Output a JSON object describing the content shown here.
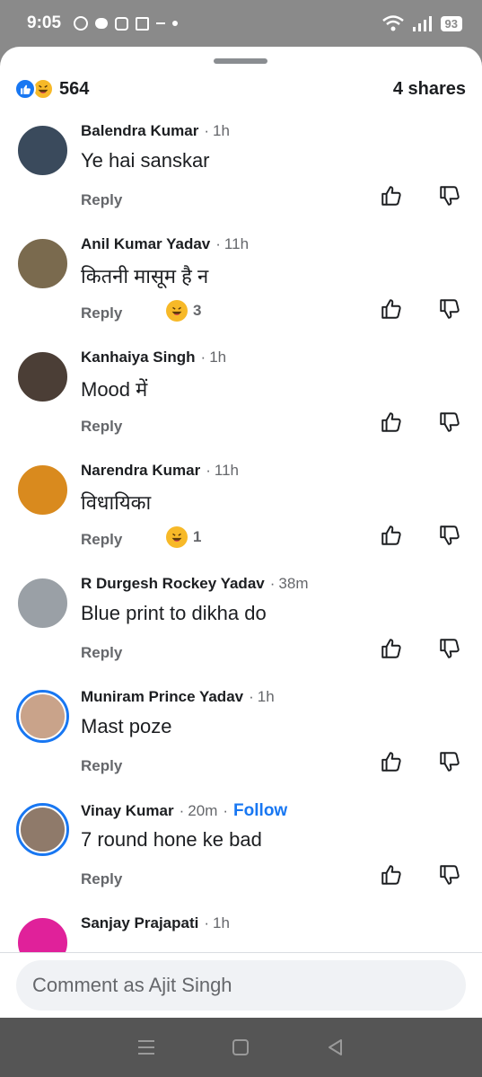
{
  "status_bar": {
    "time": "9:05",
    "battery": "93"
  },
  "summary": {
    "reaction_count": "564",
    "shares": "4 shares"
  },
  "comments": [
    {
      "name": "Balendra Kumar",
      "time": "1h",
      "text": "Ye hai sanskar",
      "reply": "Reply",
      "haha_count": null,
      "avatar_color": "#3a4a5c",
      "ring": false,
      "follow": null
    },
    {
      "name": "Anil Kumar Yadav",
      "time": "11h",
      "text": "कितनी मासूम है न",
      "reply": "Reply",
      "haha_count": "3",
      "avatar_color": "#7a6a4e",
      "ring": false,
      "follow": null
    },
    {
      "name": "Kanhaiya Singh",
      "time": "1h",
      "text": "Mood में",
      "reply": "Reply",
      "haha_count": null,
      "avatar_color": "#4b3e36",
      "ring": false,
      "follow": null
    },
    {
      "name": "Narendra Kumar",
      "time": "11h",
      "text": "विधायिका",
      "reply": "Reply",
      "haha_count": "1",
      "avatar_color": "#d98a1e",
      "ring": false,
      "follow": null
    },
    {
      "name": "R Durgesh Rockey Yadav",
      "time": "38m",
      "text": "Blue print to dikha do",
      "reply": "Reply",
      "haha_count": null,
      "avatar_color": "#9aa0a6",
      "ring": false,
      "follow": null
    },
    {
      "name": "Muniram Prince Yadav",
      "time": "1h",
      "text": "Mast poze",
      "reply": "Reply",
      "haha_count": null,
      "avatar_color": "#c9a38a",
      "ring": true,
      "follow": null
    },
    {
      "name": "Vinay Kumar",
      "time": "20m",
      "text": "7 round hone ke bad",
      "reply": "Reply",
      "haha_count": null,
      "avatar_color": "#8f7a6a",
      "ring": true,
      "follow": "Follow"
    },
    {
      "name": "Sanjay Prajapati",
      "time": "1h",
      "text": "",
      "reply": "",
      "haha_count": null,
      "avatar_color": "#e0219a",
      "ring": false,
      "follow": null
    }
  ],
  "composer": {
    "placeholder": "Comment as Ajit Singh"
  },
  "icons": {
    "like": "like-icon",
    "haha": "haha-icon",
    "thumbs_up": "thumbs-up-icon",
    "thumbs_down": "thumbs-down-icon",
    "nav_menu": "menu-icon",
    "nav_home": "home-icon",
    "nav_back": "back-icon"
  },
  "colors": {
    "accent": "#1877f2",
    "haha": "#f7b928",
    "muted": "#65676b"
  }
}
